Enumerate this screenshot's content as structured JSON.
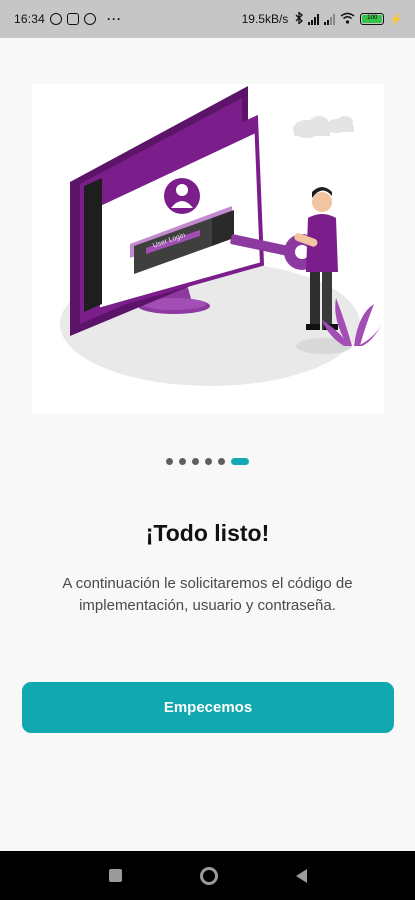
{
  "status_bar": {
    "time": "16:34",
    "net_speed": "19.5kB/s",
    "battery_level": "100",
    "left_icons": [
      "whatsapp-icon",
      "flipboard-icon",
      "chrome-icon"
    ],
    "right_icons": [
      "bluetooth-icon",
      "signal-icon",
      "signal-icon",
      "wifi-icon",
      "battery-icon",
      "charging-icon"
    ]
  },
  "illustration": {
    "login_box_text": "User Login"
  },
  "pager": {
    "count": 6,
    "active_index": 5
  },
  "main": {
    "title": "¡Todo listo!",
    "description": "A continuación le solicitaremos el código de implementación, usuario y contraseña.",
    "cta_label": "Empecemos"
  },
  "colors": {
    "accent": "#11a8b0",
    "illustration_purple": "#7b1e8c",
    "status_bar_bg": "#c6c6c6",
    "page_bg": "#f8f8f8"
  }
}
